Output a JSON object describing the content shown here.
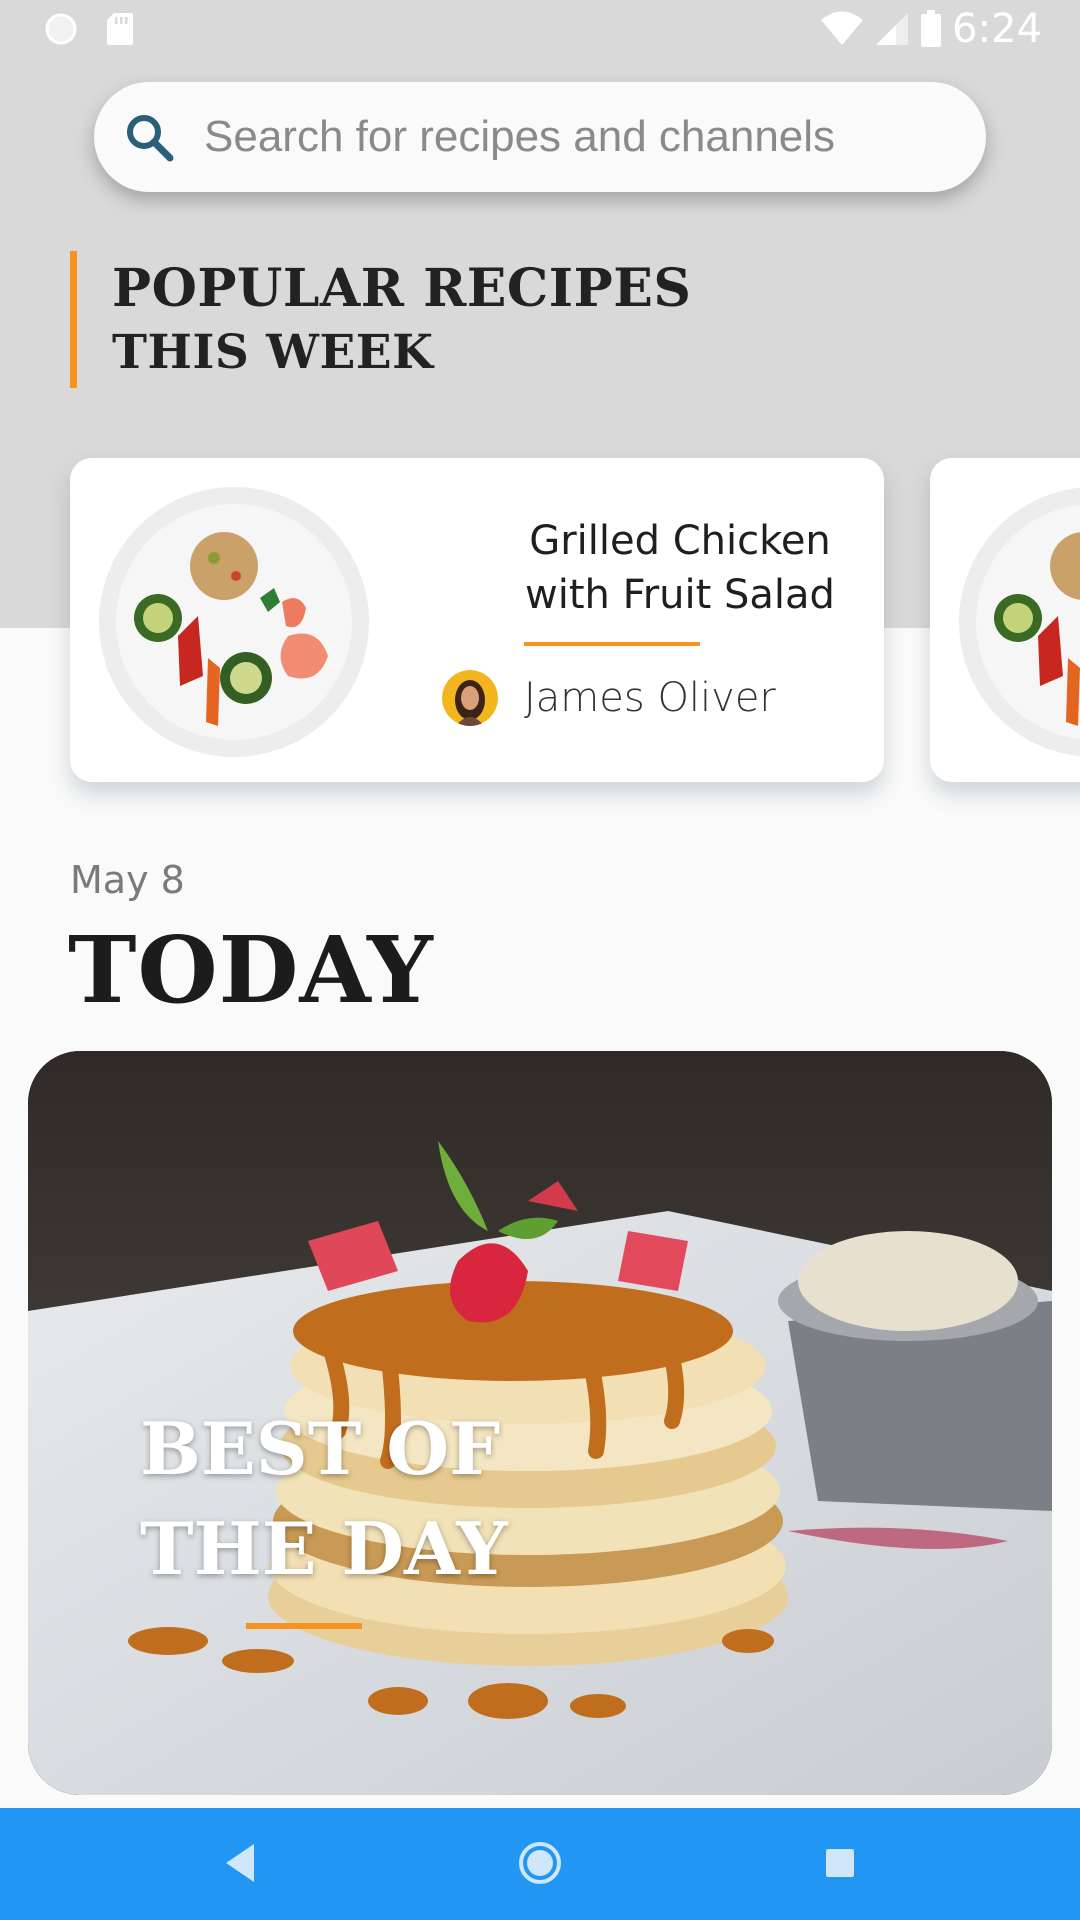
{
  "status_bar": {
    "time": "6:24",
    "left_icons": [
      "circle-indicator-icon",
      "sd-card-icon"
    ],
    "right_icons": [
      "wifi-icon",
      "signal-icon",
      "battery-icon"
    ]
  },
  "search": {
    "placeholder": "Search for recipes and channels",
    "icon": "search-icon"
  },
  "popular": {
    "title_line1": "POPULAR RECIPES",
    "title_line2": "THIS WEEK",
    "cards": [
      {
        "title_line1": "Grilled Chicken",
        "title_line2": "with Fruit Salad",
        "author": "James Oliver"
      }
    ]
  },
  "today": {
    "date": "May 8",
    "title": "TODAY",
    "hero_line1": "BEST OF",
    "hero_line2": "THE DAY"
  },
  "nav": {
    "icons": [
      "back-icon",
      "home-icon",
      "recents-icon"
    ]
  },
  "colors": {
    "accent": "#f7931e",
    "nav_bar": "#2196f3",
    "top_background": "#d9d9d9",
    "page_background": "#fafafa"
  }
}
